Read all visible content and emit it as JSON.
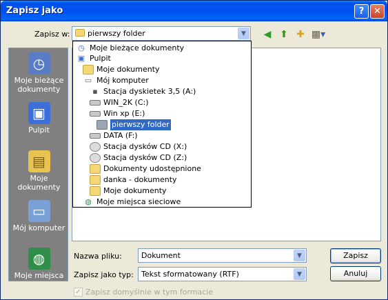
{
  "window": {
    "title": "Zapisz jako"
  },
  "location": {
    "label": "Zapisz w:",
    "value": "pierwszy folder"
  },
  "dropdown": {
    "items": [
      {
        "label": "Moje bieżące dokumenty",
        "icon": "recent-icon"
      },
      {
        "label": "Pulpit",
        "icon": "desktop-icon"
      },
      {
        "label": "Moje dokumenty",
        "icon": "folder-icon"
      },
      {
        "label": "Mój komputer",
        "icon": "computer-icon"
      },
      {
        "label": "Stacja dyskietek 3,5 (A:)",
        "icon": "floppy-icon"
      },
      {
        "label": "WIN_2K (C:)",
        "icon": "drive-icon"
      },
      {
        "label": "Win xp (E:)",
        "icon": "drive-icon"
      },
      {
        "label": "pierwszy folder",
        "icon": "folder-open-icon"
      },
      {
        "label": "DATA (F:)",
        "icon": "drive-icon"
      },
      {
        "label": "Stacja dysków CD (X:)",
        "icon": "cd-icon"
      },
      {
        "label": "Stacja dysków CD (Z:)",
        "icon": "cd-icon"
      },
      {
        "label": "Dokumenty udostępnione",
        "icon": "folder-icon"
      },
      {
        "label": "danka - dokumenty",
        "icon": "folder-icon"
      },
      {
        "label": "Moje dokumenty",
        "icon": "folder-icon"
      },
      {
        "label": "Moje miejsca sieciowe",
        "icon": "network-icon"
      }
    ]
  },
  "places": [
    {
      "label": "Moje bieżące dokumenty",
      "icon": "recent-icon"
    },
    {
      "label": "Pulpit",
      "icon": "desktop-icon"
    },
    {
      "label": "Moje dokumenty",
      "icon": "documents-icon"
    },
    {
      "label": "Mój komputer",
      "icon": "computer-icon"
    },
    {
      "label": "Moje miejsca",
      "icon": "network-icon"
    }
  ],
  "form": {
    "filename_label": "Nazwa pliku:",
    "filename_value": "Dokument",
    "type_label": "Zapisz jako typ:",
    "type_value": "Tekst sformatowany (RTF)",
    "default_format_label": "Zapisz domyślnie w tym formacie"
  },
  "buttons": {
    "save": "Zapisz",
    "cancel": "Anuluj"
  },
  "colors": {
    "title_bar": "#0053ee",
    "selection": "#316ac5",
    "places_bg": "#808080"
  }
}
